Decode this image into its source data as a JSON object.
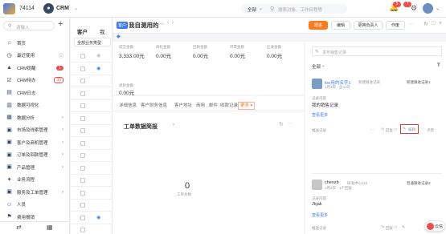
{
  "topbar": {
    "company_id": "74114",
    "crm_label": "CRM",
    "search_scope": "全部",
    "search_placeholder": "搜索对象、工作日程等",
    "notify_count": "5",
    "help_badge": "7"
  },
  "sidebar": {
    "search_placeholder": "请输入",
    "items": [
      {
        "label": "首页",
        "icon": "home-icon"
      },
      {
        "label": "最近使用",
        "icon": "clock-icon"
      },
      {
        "label": "CRM提醒",
        "icon": "bell-icon",
        "badge": "1"
      },
      {
        "label": "CRM待办",
        "icon": "todo-icon",
        "badge": "33"
      },
      {
        "label": "CRM日志",
        "icon": "log-icon"
      },
      {
        "label": "数据可视化",
        "icon": "chart-icon"
      },
      {
        "label": "数据分析",
        "icon": "analytics-icon"
      },
      {
        "label": "市场及线索管理",
        "icon": "market-icon"
      },
      {
        "label": "客户及商机管理",
        "icon": "customer-icon"
      },
      {
        "label": "订单及回款管理",
        "icon": "order-icon"
      },
      {
        "label": "产品管理",
        "icon": "product-icon"
      },
      {
        "label": "业务流程",
        "icon": "flow-icon"
      },
      {
        "label": "服务及工单管理",
        "icon": "service-icon"
      },
      {
        "label": "人员",
        "icon": "people-icon"
      },
      {
        "label": "费用报销",
        "icon": "expense-icon"
      }
    ]
  },
  "listpane": {
    "title": "客户",
    "title2": "我",
    "filter_label": "全部业务类型"
  },
  "detail": {
    "type_tag": "客户",
    "title": "我自测用的",
    "actions": {
      "follow": "跟进",
      "edit": "编辑",
      "change_owner": "更换负责人",
      "more": "作废"
    },
    "stats": [
      {
        "label": "成交金额",
        "value": "3,333.00元"
      },
      {
        "label": "商机金额",
        "value": "0.00元"
      },
      {
        "label": "回款金额",
        "value": "0.00元"
      },
      {
        "label": "开票金额",
        "value": "0.00元"
      },
      {
        "label": "应收金额",
        "value": "0.00元"
      }
    ],
    "stat6": {
      "label": "退款金额",
      "value": "0.00元"
    },
    "tabs": [
      "详细信息",
      "客户财务信息",
      "客户地址",
      "商用",
      "邮件",
      "收款记录",
      "更多 ▾"
    ],
    "workorder_title": "工单数据简报",
    "workorder_value": "0",
    "workorder_unit": "工单总数"
  },
  "feed": {
    "input_placeholder": "发布销售记录",
    "filter_all": "全部",
    "filter_t": "T",
    "posts": [
      {
        "author": "lee用的名字1",
        "tag": "新建跟进记录",
        "meta": "1月1日 · 全公司",
        "type": "新建跟进记录1",
        "record_label": "记录内容",
        "content": "我的销售记录",
        "more": "查看更多",
        "action_tag": "推送记录",
        "reply": "回复",
        "edit": "编辑",
        "like": "点赞"
      },
      {
        "author": "chenzb",
        "tag": "研发中心113",
        "meta": "1月2日 · 1个回复",
        "type": "普通跟进记录2",
        "record_label": "记录内容",
        "content": "Jkjak",
        "more": "查看更多",
        "action_tag": "推送记录",
        "reply": "回复",
        "like": "点赞"
      }
    ]
  },
  "floating": {
    "label": "云信"
  }
}
